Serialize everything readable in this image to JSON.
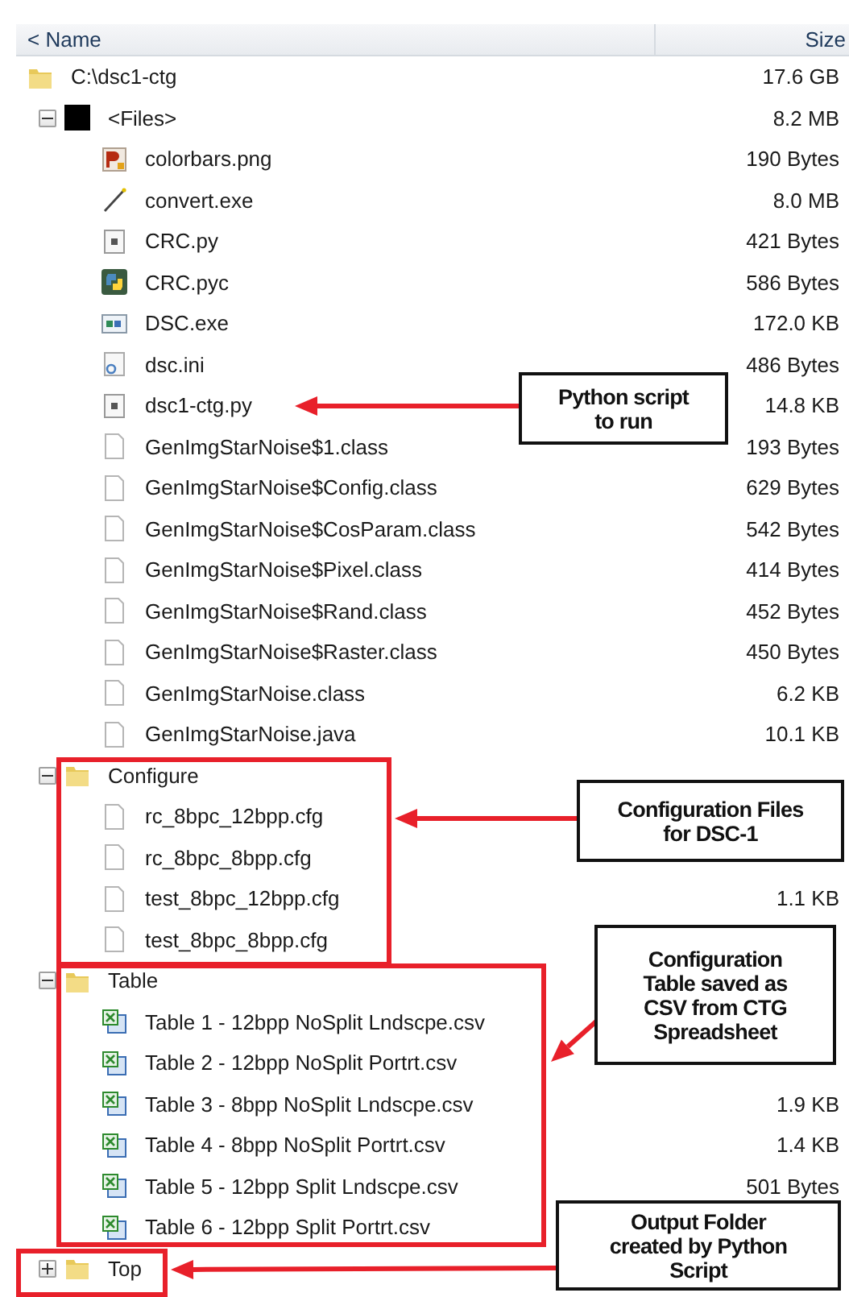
{
  "header": {
    "name_column": "< Name",
    "size_column": "Size"
  },
  "tree": [
    {
      "name": "C:\\dsc1-ctg",
      "size": "17.6 GB",
      "kind": "folder",
      "children": [
        {
          "name": "<Files>",
          "size": "8.2 MB",
          "kind": "block",
          "expanded": true,
          "children": [
            {
              "name": "colorbars.png",
              "size": "190 Bytes",
              "kind": "image"
            },
            {
              "name": "convert.exe",
              "size": "8.0 MB",
              "kind": "wand"
            },
            {
              "name": "CRC.py",
              "size": "421 Bytes",
              "kind": "script"
            },
            {
              "name": "CRC.pyc",
              "size": "586 Bytes",
              "kind": "python"
            },
            {
              "name": "DSC.exe",
              "size": "172.0 KB",
              "kind": "program"
            },
            {
              "name": "dsc.ini",
              "size": "486 Bytes",
              "kind": "settings"
            },
            {
              "name": "dsc1-ctg.py",
              "size": "14.8 KB",
              "kind": "script"
            },
            {
              "name": "GenImgStarNoise$1.class",
              "size": "193 Bytes",
              "kind": "file"
            },
            {
              "name": "GenImgStarNoise$Config.class",
              "size": "629 Bytes",
              "kind": "file"
            },
            {
              "name": "GenImgStarNoise$CosParam.class",
              "size": "542 Bytes",
              "kind": "file"
            },
            {
              "name": "GenImgStarNoise$Pixel.class",
              "size": "414 Bytes",
              "kind": "file"
            },
            {
              "name": "GenImgStarNoise$Rand.class",
              "size": "452 Bytes",
              "kind": "file"
            },
            {
              "name": "GenImgStarNoise$Raster.class",
              "size": "450 Bytes",
              "kind": "file"
            },
            {
              "name": "GenImgStarNoise.class",
              "size": "6.2 KB",
              "kind": "file"
            },
            {
              "name": "GenImgStarNoise.java",
              "size": "10.1 KB",
              "kind": "file"
            }
          ]
        },
        {
          "name": "Configure",
          "kind": "folder",
          "expanded": true,
          "children": [
            {
              "name": "rc_8bpc_12bpp.cfg",
              "kind": "file"
            },
            {
              "name": "rc_8bpc_8bpp.cfg",
              "kind": "file"
            },
            {
              "name": "test_8bpc_12bpp.cfg",
              "size": "1.1 KB",
              "kind": "file"
            },
            {
              "name": "test_8bpc_8bpp.cfg",
              "kind": "file"
            }
          ]
        },
        {
          "name": "Table",
          "kind": "folder",
          "expanded": true,
          "children": [
            {
              "name": "Table 1 - 12bpp NoSplit Lndscpe.csv",
              "kind": "sheet"
            },
            {
              "name": "Table 2 - 12bpp NoSplit Portrt.csv",
              "kind": "sheet"
            },
            {
              "name": "Table 3 - 8bpp NoSplit Lndscpe.csv",
              "size": "1.9 KB",
              "kind": "sheet"
            },
            {
              "name": "Table 4 - 8bpp NoSplit Portrt.csv",
              "size": "1.4 KB",
              "kind": "sheet"
            },
            {
              "name": "Table 5 - 12bpp Split Lndscpe.csv",
              "size": "501 Bytes",
              "kind": "sheet"
            },
            {
              "name": "Table 6 - 12bpp Split Portrt.csv",
              "kind": "sheet"
            }
          ]
        },
        {
          "name": "Top",
          "kind": "folder",
          "expanded": false
        }
      ]
    }
  ],
  "callouts": [
    "Python script\nto run",
    "Configuration Files\nfor DSC-1",
    "Configuration\nTable saved as\nCSV from CTG\nSpreadsheet",
    "Output Folder\ncreated by Python\nScript"
  ]
}
